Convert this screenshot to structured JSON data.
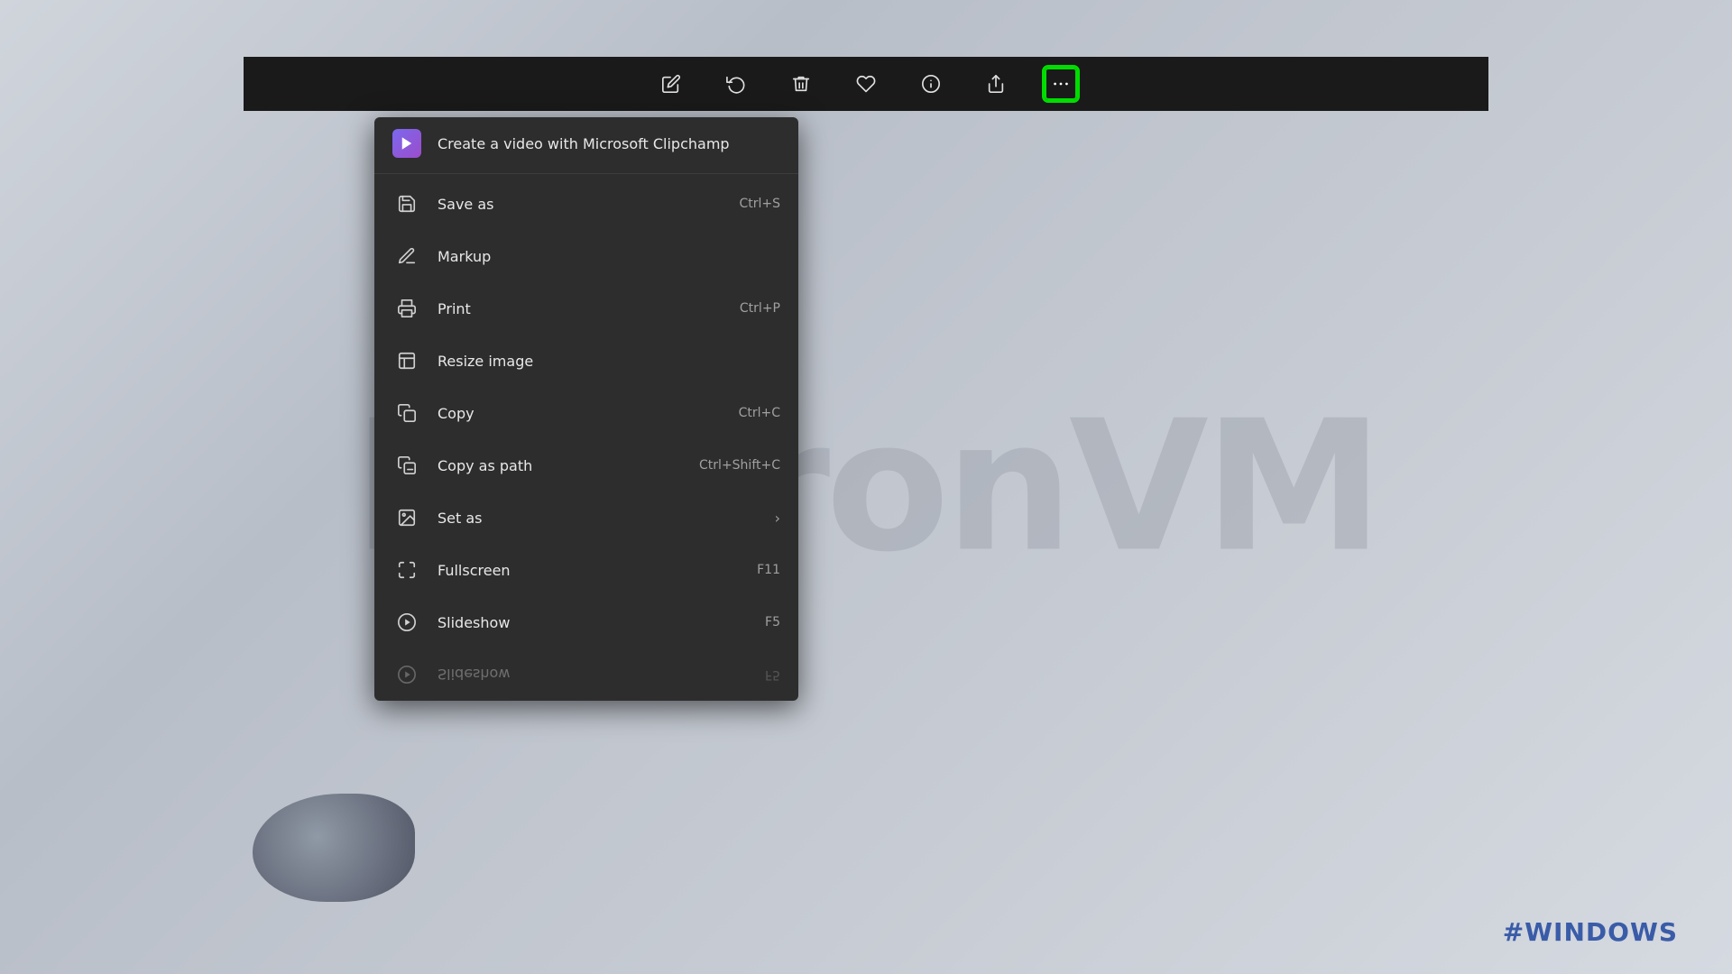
{
  "background": {
    "watermark_text": "NeuronVM",
    "windows_tag": "#WINDOWS"
  },
  "toolbar": {
    "icons": [
      {
        "name": "edit-icon",
        "unicode": "✏",
        "label": "Edit"
      },
      {
        "name": "rotate-icon",
        "unicode": "↺",
        "label": "Rotate"
      },
      {
        "name": "delete-icon",
        "unicode": "🗑",
        "label": "Delete"
      },
      {
        "name": "favorite-icon",
        "unicode": "♡",
        "label": "Favorite"
      },
      {
        "name": "info-icon",
        "unicode": "ℹ",
        "label": "Info"
      },
      {
        "name": "share-icon",
        "unicode": "⤴",
        "label": "Share"
      },
      {
        "name": "more-icon",
        "unicode": "•••",
        "label": "More options"
      }
    ]
  },
  "context_menu": {
    "items": [
      {
        "id": "create-video",
        "label": "Create a video with Microsoft Clipchamp",
        "icon_type": "clipchamp",
        "shortcut": "",
        "has_arrow": false
      },
      {
        "id": "save-as",
        "label": "Save as",
        "icon_type": "save",
        "shortcut": "Ctrl+S",
        "has_arrow": false
      },
      {
        "id": "markup",
        "label": "Markup",
        "icon_type": "markup",
        "shortcut": "",
        "has_arrow": false
      },
      {
        "id": "print",
        "label": "Print",
        "icon_type": "print",
        "shortcut": "Ctrl+P",
        "has_arrow": false
      },
      {
        "id": "resize-image",
        "label": "Resize image",
        "icon_type": "resize",
        "shortcut": "",
        "has_arrow": false
      },
      {
        "id": "copy",
        "label": "Copy",
        "icon_type": "copy",
        "shortcut": "Ctrl+C",
        "has_arrow": false
      },
      {
        "id": "copy-as-path",
        "label": "Copy as path",
        "icon_type": "copy-path",
        "shortcut": "Ctrl+Shift+C",
        "has_arrow": false
      },
      {
        "id": "set-as",
        "label": "Set as",
        "icon_type": "set-as",
        "shortcut": "",
        "has_arrow": true
      },
      {
        "id": "fullscreen",
        "label": "Fullscreen",
        "icon_type": "fullscreen",
        "shortcut": "F11",
        "has_arrow": false
      },
      {
        "id": "slideshow",
        "label": "Slideshow",
        "icon_type": "slideshow",
        "shortcut": "F5",
        "has_arrow": false
      },
      {
        "id": "slideshow-clipped",
        "label": "Slideshow",
        "icon_type": "slideshow",
        "shortcut": "F5",
        "has_arrow": false,
        "clipped": true
      }
    ]
  }
}
